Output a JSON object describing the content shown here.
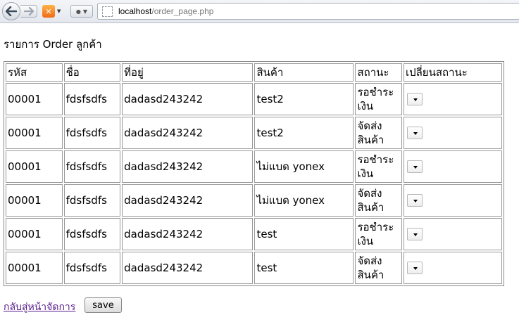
{
  "browser": {
    "url_host": "localhost",
    "url_path": "/order_page.php"
  },
  "page": {
    "title": "รายการ Order ลูกค้า",
    "back_link": "กลับสู่หน้าจัดการ",
    "save_label": "save"
  },
  "table": {
    "headers": [
      "รหัส",
      "ชื่อ",
      "ที่อยู่",
      "สินค้า",
      "สถานะ",
      "เปลี่ยนสถานะ"
    ],
    "rows": [
      {
        "id": "00001",
        "name": "fdsfsdfs",
        "address": "dadasd243242",
        "product": "test2",
        "status": "รอชำระเงิน"
      },
      {
        "id": "00001",
        "name": "fdsfsdfs",
        "address": "dadasd243242",
        "product": "test2",
        "status": "จัดส่งสินค้า"
      },
      {
        "id": "00001",
        "name": "fdsfsdfs",
        "address": "dadasd243242",
        "product": "ไม่แบด yonex",
        "status": "รอชำระเงิน"
      },
      {
        "id": "00001",
        "name": "fdsfsdfs",
        "address": "dadasd243242",
        "product": "ไม่แบด yonex",
        "status": "จัดส่งสินค้า"
      },
      {
        "id": "00001",
        "name": "fdsfsdfs",
        "address": "dadasd243242",
        "product": "test",
        "status": "รอชำระเงิน"
      },
      {
        "id": "00001",
        "name": "fdsfsdfs",
        "address": "dadasd243242",
        "product": "test",
        "status": "จัดส่งสินค้า"
      }
    ]
  },
  "icons": {
    "back": "arrow-left-icon",
    "forward": "arrow-right-icon",
    "extension": "extension-icon",
    "profile": "user-icon",
    "page": "page-icon"
  }
}
